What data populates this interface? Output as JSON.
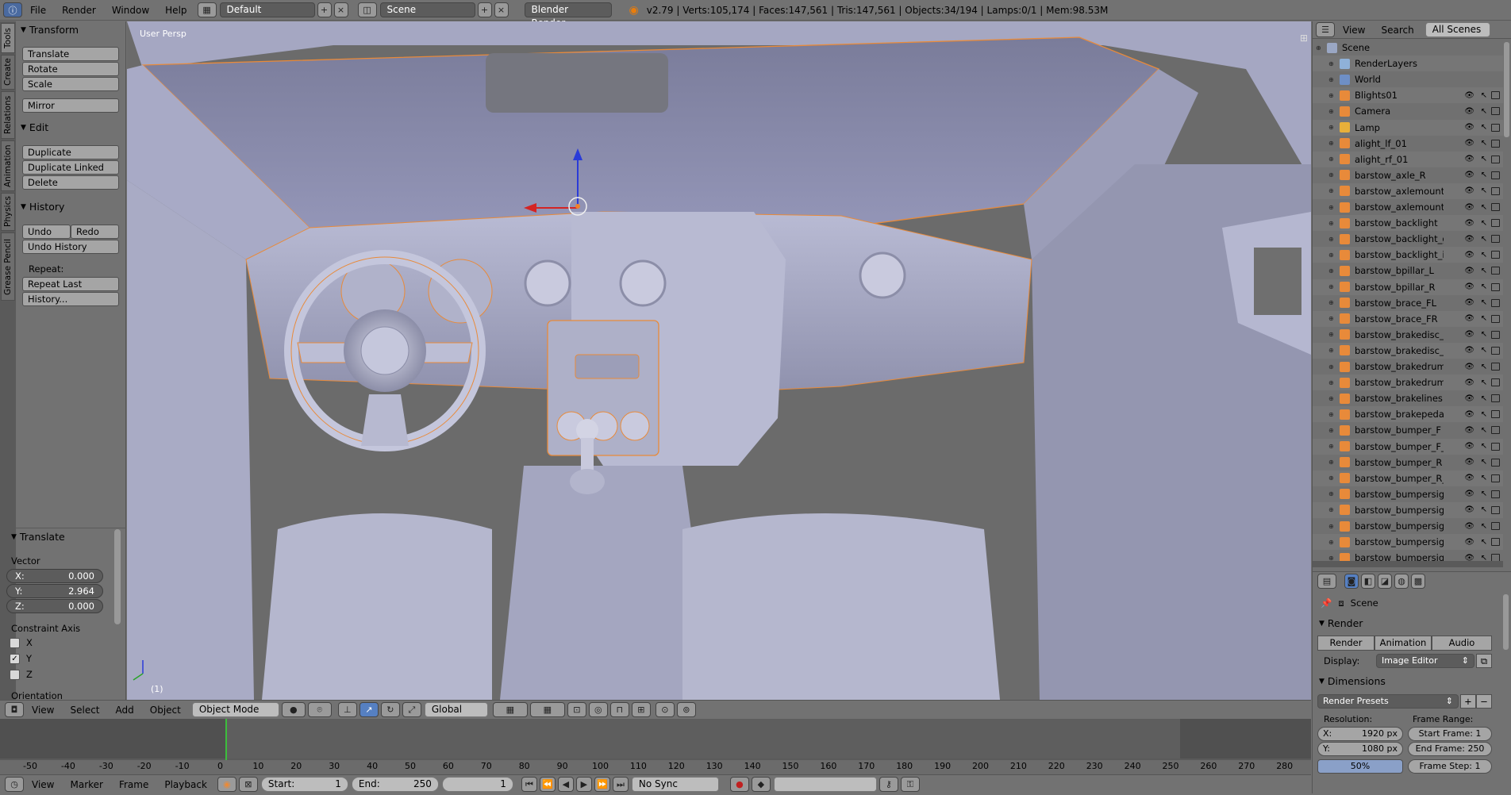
{
  "topbar": {
    "menus": [
      "File",
      "Render",
      "Window",
      "Help"
    ],
    "layout": "Default",
    "scene": "Scene",
    "engine": "Blender Render",
    "stats": "v2.79 | Verts:105,174 | Faces:147,561 | Tris:147,561 | Objects:34/194 | Lamps:0/1 | Mem:98.53M"
  },
  "tabs": [
    "Tools",
    "Create",
    "Relations",
    "Animation",
    "Physics",
    "Grease Pencil"
  ],
  "toolshelf": {
    "transform_title": "Transform",
    "translate": "Translate",
    "rotate": "Rotate",
    "scale": "Scale",
    "mirror": "Mirror",
    "edit_title": "Edit",
    "duplicate": "Duplicate",
    "duplicate_linked": "Duplicate Linked",
    "delete": "Delete",
    "history_title": "History",
    "undo": "Undo",
    "redo": "Redo",
    "undo_history": "Undo History",
    "repeat_label": "Repeat:",
    "repeat_last": "Repeat Last",
    "history": "History..."
  },
  "operator": {
    "title": "Translate",
    "vector_label": "Vector",
    "x_label": "X:",
    "x": "0.000",
    "y_label": "Y:",
    "y": "2.964",
    "z_label": "Z:",
    "z": "0.000",
    "constraint_label": "Constraint Axis",
    "cx": "X",
    "cy": "Y",
    "cz": "Z",
    "orientation_label": "Orientation"
  },
  "viewport": {
    "view_label": "User Persp",
    "frame_label": "(1)"
  },
  "viewheader": {
    "menus": [
      "View",
      "Select",
      "Add",
      "Object"
    ],
    "mode": "Object Mode",
    "orientation": "Global"
  },
  "timeline": {
    "ticks": [
      "-50",
      "-40",
      "-30",
      "-20",
      "-10",
      "0",
      "10",
      "20",
      "30",
      "40",
      "50",
      "60",
      "70",
      "80",
      "90",
      "100",
      "110",
      "120",
      "130",
      "140",
      "150",
      "160",
      "170",
      "180",
      "190",
      "200",
      "210",
      "220",
      "230",
      "240",
      "250",
      "260",
      "270",
      "280"
    ],
    "menus": [
      "View",
      "Marker",
      "Frame",
      "Playback"
    ],
    "start_label": "Start:",
    "start": "1",
    "end_label": "End:",
    "end": "250",
    "current": "1",
    "sync": "No Sync"
  },
  "outliner": {
    "menus": [
      "View",
      "Search"
    ],
    "filter": "All Scenes",
    "items": [
      {
        "name": "Scene",
        "type": "scene"
      },
      {
        "name": "RenderLayers",
        "type": "layers"
      },
      {
        "name": "World",
        "type": "world"
      },
      {
        "name": "Blights01",
        "type": "mesh"
      },
      {
        "name": "Camera",
        "type": "camera"
      },
      {
        "name": "Lamp",
        "type": "lamp"
      },
      {
        "name": "alight_lf_01",
        "type": "mesh"
      },
      {
        "name": "alight_rf_01",
        "type": "mesh"
      },
      {
        "name": "barstow_axle_R",
        "type": "mesh"
      },
      {
        "name": "barstow_axlemounts_F",
        "type": "mesh"
      },
      {
        "name": "barstow_axlemounts_R",
        "type": "mesh"
      },
      {
        "name": "barstow_backlight",
        "type": "mesh"
      },
      {
        "name": "barstow_backlight_grill",
        "type": "mesh"
      },
      {
        "name": "barstow_backlight_int",
        "type": "mesh"
      },
      {
        "name": "barstow_bpillar_L",
        "type": "mesh"
      },
      {
        "name": "barstow_bpillar_R",
        "type": "mesh"
      },
      {
        "name": "barstow_brace_FL",
        "type": "mesh"
      },
      {
        "name": "barstow_brace_FR",
        "type": "mesh"
      },
      {
        "name": "barstow_brakedisc_FL",
        "type": "mesh"
      },
      {
        "name": "barstow_brakedisc_FR",
        "type": "mesh"
      },
      {
        "name": "barstow_brakedrum_R",
        "type": "mesh"
      },
      {
        "name": "barstow_brakedrum_R",
        "type": "mesh"
      },
      {
        "name": "barstow_brakelines",
        "type": "mesh"
      },
      {
        "name": "barstow_brakepedal",
        "type": "mesh"
      },
      {
        "name": "barstow_bumper_F",
        "type": "mesh"
      },
      {
        "name": "barstow_bumper_F_pa",
        "type": "mesh"
      },
      {
        "name": "barstow_bumper_R",
        "type": "mesh"
      },
      {
        "name": "barstow_bumper_R_pa",
        "type": "mesh"
      },
      {
        "name": "barstow_bumpersignal",
        "type": "mesh"
      },
      {
        "name": "barstow_bumpersignal",
        "type": "mesh"
      },
      {
        "name": "barstow_bumpersignal",
        "type": "mesh"
      },
      {
        "name": "barstow_bumpersignal",
        "type": "mesh"
      },
      {
        "name": "barstow_bumpersignal",
        "type": "mesh"
      }
    ]
  },
  "props": {
    "scene": "Scene",
    "render_title": "Render",
    "render_btn": "Render",
    "animation_btn": "Animation",
    "audio_btn": "Audio",
    "display_label": "Display:",
    "display": "Image Editor",
    "dimensions_title": "Dimensions",
    "presets": "Render Presets",
    "resolution_label": "Resolution:",
    "res_x_label": "X:",
    "res_x": "1920 px",
    "res_y_label": "Y:",
    "res_y": "1080 px",
    "res_pct": "50%",
    "frame_range_label": "Frame Range:",
    "start_frame": "Start Frame: 1",
    "end_frame": "End Frame: 250",
    "frame_step": "Frame Step: 1"
  },
  "colors": {
    "accent": "#e88a3a",
    "selected": "#f0812b",
    "bg": "#727272",
    "mesh": "#b2b4cc"
  }
}
